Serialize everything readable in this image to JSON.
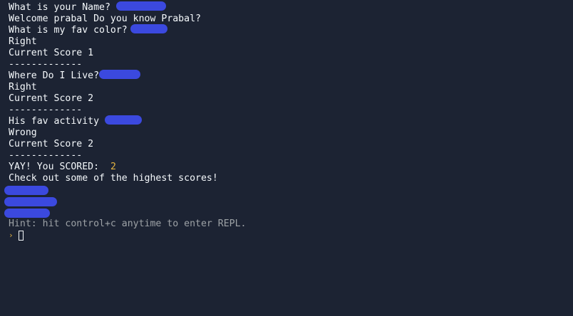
{
  "console": {
    "lines": [
      "What is your Name?",
      "Welcome prabal Do you know Prabal?",
      "What is my fav color?",
      "Right",
      "Current Score 1",
      "-------------",
      "Where Do I Live?",
      "Right",
      "Current Score 2",
      "-------------",
      "His fav activity",
      "Wrong",
      "Current Score 2",
      "-------------",
      "YAY! You SCORED:",
      "2",
      "Check out some of the highest scores!",
      "Hint: hit control+c anytime to enter REPL."
    ],
    "prompt_icon": "chevron-right-icon",
    "redaction_color": "#3b49df",
    "number_color": "#e3b341",
    "hint_color": "#9da2a6",
    "text_color": "#f5f9fc",
    "background": "#1c2333"
  }
}
